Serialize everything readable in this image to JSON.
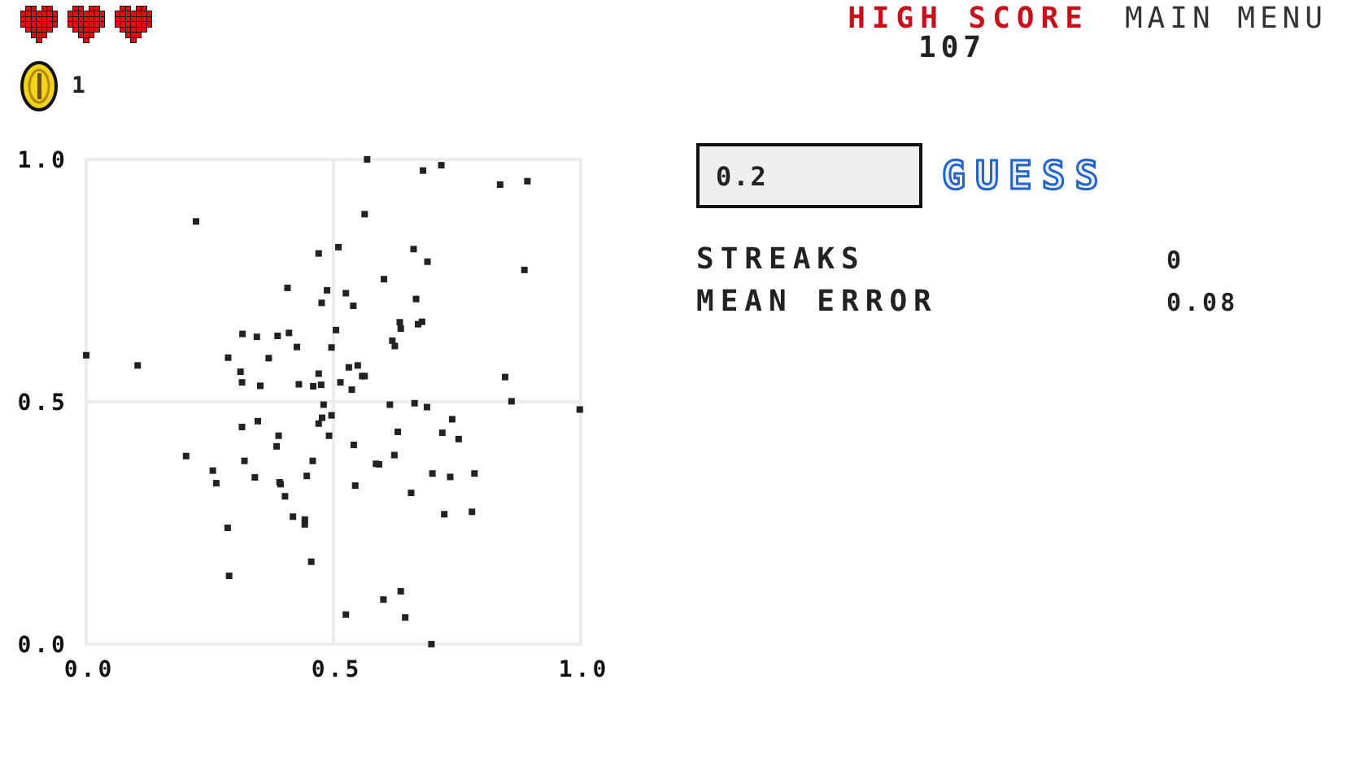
{
  "hearts": [
    {
      "full": true
    },
    {
      "full": true
    },
    {
      "full": true
    }
  ],
  "coins": "1",
  "high_score": {
    "label": "HIGH SCORE",
    "value": "107"
  },
  "main_menu": "MAIN MENU",
  "guess_field": {
    "value": "0.2"
  },
  "guess_button": "GUESS",
  "stats": [
    {
      "label": "STREAKS",
      "value": "0"
    },
    {
      "label": "MEAN ERROR",
      "value": "0.08"
    }
  ],
  "chart_data": {
    "type": "scatter",
    "xlim": [
      0,
      1
    ],
    "ylim": [
      0,
      1
    ],
    "xticks": [
      {
        "value": 0,
        "label": "0.0"
      },
      {
        "value": 0.5,
        "label": "0.5"
      },
      {
        "value": 1,
        "label": "1.0"
      }
    ],
    "yticks": [
      {
        "value": 0,
        "label": "0.0"
      },
      {
        "value": 0.5,
        "label": "0.5"
      },
      {
        "value": 1,
        "label": "1.0"
      }
    ],
    "x": [
      0.568,
      0.718,
      0.681,
      0.837,
      0.892,
      0.222,
      0.563,
      0.47,
      0.51,
      0.662,
      0.69,
      0.886,
      0.602,
      0.407,
      0.487,
      0.525,
      0.667,
      0.476,
      0.54,
      0.634,
      0.636,
      0.671,
      0.679,
      0.505,
      0.316,
      0.345,
      0.387,
      0.41,
      0.426,
      0.496,
      0.619,
      0.624,
      0.0,
      0.104,
      0.287,
      0.369,
      0.312,
      0.315,
      0.352,
      0.43,
      0.459,
      0.475,
      0.47,
      0.531,
      0.549,
      0.558,
      0.563,
      0.514,
      0.537,
      0.847,
      0.86,
      0.998,
      0.48,
      0.614,
      0.664,
      0.689,
      0.477,
      0.496,
      0.47,
      0.315,
      0.347,
      0.389,
      0.385,
      0.491,
      0.63,
      0.74,
      0.72,
      0.753,
      0.541,
      0.623,
      0.202,
      0.256,
      0.263,
      0.32,
      0.341,
      0.391,
      0.393,
      0.402,
      0.458,
      0.446,
      0.544,
      0.586,
      0.592,
      0.657,
      0.7,
      0.736,
      0.785,
      0.724,
      0.78,
      0.418,
      0.442,
      0.442,
      0.286,
      0.455,
      0.289,
      0.636,
      0.601,
      0.525,
      0.645,
      0.698
    ],
    "series": [
      {
        "values": [
          1.0,
          0.988,
          0.977,
          0.948,
          0.955,
          0.872,
          0.887,
          0.806,
          0.819,
          0.815,
          0.789,
          0.772,
          0.753,
          0.735,
          0.73,
          0.724,
          0.712,
          0.704,
          0.698,
          0.664,
          0.651,
          0.66,
          0.665,
          0.648,
          0.64,
          0.634,
          0.636,
          0.642,
          0.613,
          0.612,
          0.626,
          0.615,
          0.596,
          0.575,
          0.591,
          0.59,
          0.562,
          0.54,
          0.533,
          0.536,
          0.532,
          0.535,
          0.558,
          0.571,
          0.575,
          0.553,
          0.553,
          0.54,
          0.525,
          0.551,
          0.501,
          0.484,
          0.494,
          0.494,
          0.497,
          0.489,
          0.467,
          0.472,
          0.455,
          0.448,
          0.46,
          0.43,
          0.408,
          0.43,
          0.438,
          0.464,
          0.436,
          0.423,
          0.411,
          0.39,
          0.388,
          0.358,
          0.332,
          0.378,
          0.344,
          0.334,
          0.33,
          0.305,
          0.378,
          0.347,
          0.327,
          0.372,
          0.371,
          0.312,
          0.352,
          0.345,
          0.352,
          0.268,
          0.273,
          0.263,
          0.257,
          0.247,
          0.24,
          0.17,
          0.141,
          0.109,
          0.092,
          0.061,
          0.055,
          0.0
        ]
      }
    ]
  }
}
